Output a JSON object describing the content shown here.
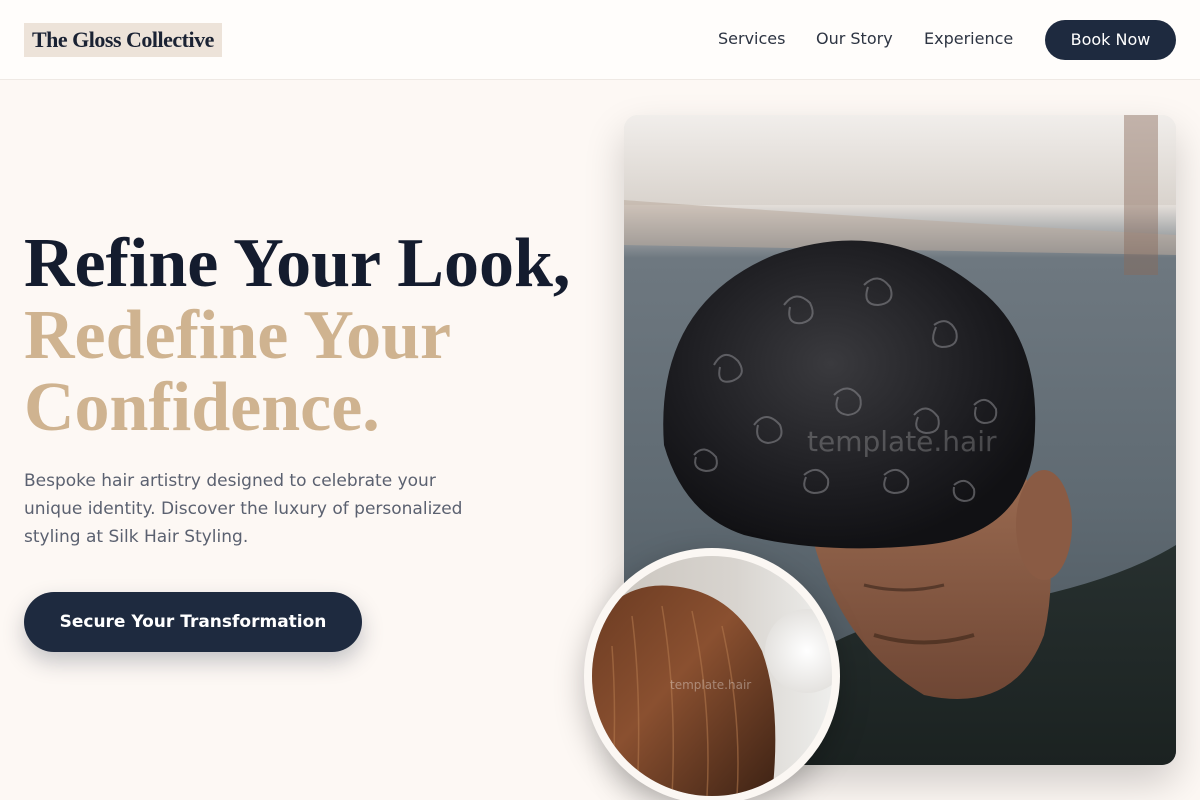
{
  "brand": {
    "name": "The Gloss Collective"
  },
  "nav": {
    "links": [
      "Services",
      "Our Story",
      "Experience"
    ],
    "cta_label": "Book Now"
  },
  "hero": {
    "headline_line1": "Refine Your Look,",
    "headline_line2": "Redefine Your",
    "headline_line3": "Confidence.",
    "subtitle": "Bespoke hair artistry designed to celebrate your unique identity. Discover the luxury of personalized styling at Silk Hair Styling.",
    "cta_label": "Secure Your Transformation"
  },
  "images": {
    "main_watermark": "template.hair",
    "inset_watermark": "template.hair"
  },
  "colors": {
    "navy": "#1e2a3f",
    "gold": "#cfb390",
    "background": "#fdf8f4"
  }
}
